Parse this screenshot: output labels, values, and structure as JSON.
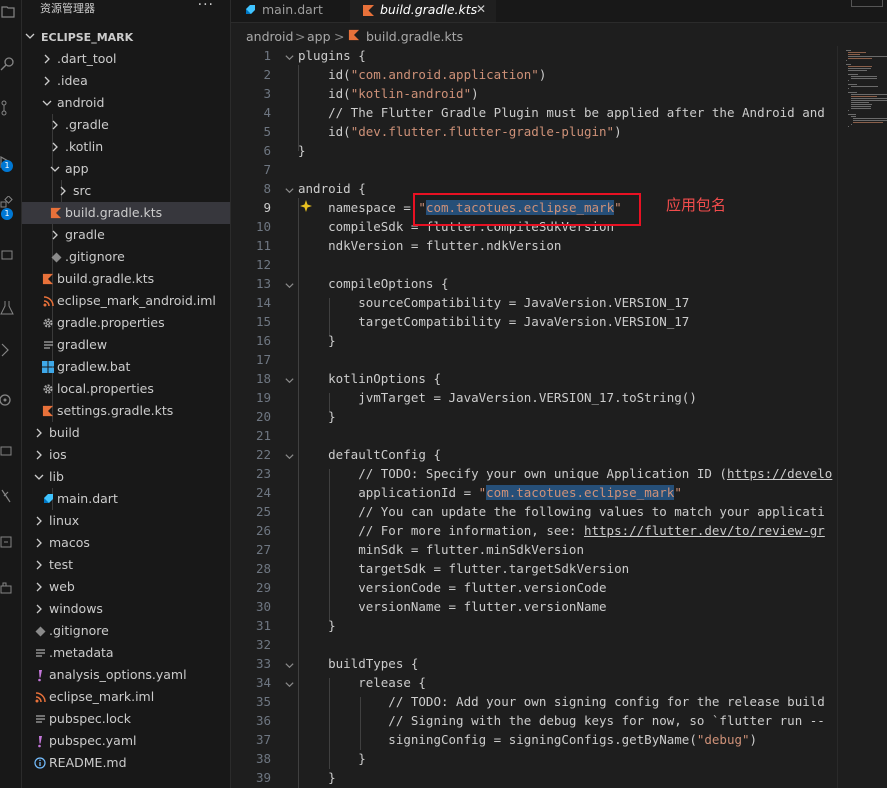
{
  "sidebar": {
    "title": "资源管理器",
    "more": "···",
    "root": "ECLIPSE_MARK",
    "items": [
      {
        "label": ".dart_tool",
        "icon": "chevron-right-icon"
      },
      {
        "label": ".idea",
        "icon": "chevron-right-icon"
      },
      {
        "label": "android",
        "icon": "chevron-down-icon"
      },
      {
        "label": ".gradle",
        "icon": "chevron-right-icon"
      },
      {
        "label": ".kotlin",
        "icon": "chevron-right-icon"
      },
      {
        "label": "app",
        "icon": "chevron-down-icon"
      },
      {
        "label": "src",
        "icon": "chevron-right-icon"
      },
      {
        "label": "build.gradle.kts",
        "icon": "kotlin-icon"
      },
      {
        "label": "gradle",
        "icon": "chevron-right-icon"
      },
      {
        "label": ".gitignore",
        "icon": "git-icon"
      },
      {
        "label": "build.gradle.kts",
        "icon": "kotlin-icon"
      },
      {
        "label": "eclipse_mark_android.iml",
        "icon": "rss-icon"
      },
      {
        "label": "gradle.properties",
        "icon": "gear-icon"
      },
      {
        "label": "gradlew",
        "icon": "lines-icon"
      },
      {
        "label": "gradlew.bat",
        "icon": "windows-icon"
      },
      {
        "label": "local.properties",
        "icon": "gear-icon"
      },
      {
        "label": "settings.gradle.kts",
        "icon": "kotlin-icon"
      },
      {
        "label": "build",
        "icon": "chevron-right-icon"
      },
      {
        "label": "ios",
        "icon": "chevron-right-icon"
      },
      {
        "label": "lib",
        "icon": "chevron-down-icon"
      },
      {
        "label": "main.dart",
        "icon": "dart-icon"
      },
      {
        "label": "linux",
        "icon": "chevron-right-icon"
      },
      {
        "label": "macos",
        "icon": "chevron-right-icon"
      },
      {
        "label": "test",
        "icon": "chevron-right-icon"
      },
      {
        "label": "web",
        "icon": "chevron-right-icon"
      },
      {
        "label": "windows",
        "icon": "chevron-right-icon"
      },
      {
        "label": ".gitignore",
        "icon": "git-icon"
      },
      {
        "label": ".metadata",
        "icon": "lines-icon"
      },
      {
        "label": "analysis_options.yaml",
        "icon": "exclamation-icon"
      },
      {
        "label": "eclipse_mark.iml",
        "icon": "rss-icon"
      },
      {
        "label": "pubspec.lock",
        "icon": "lines-icon"
      },
      {
        "label": "pubspec.yaml",
        "icon": "exclamation-icon"
      },
      {
        "label": "README.md",
        "icon": "info-icon"
      }
    ]
  },
  "activity": {
    "badges": [
      "1",
      "1"
    ]
  },
  "tabs": [
    {
      "label": "main.dart",
      "active": false
    },
    {
      "label": "build.gradle.kts",
      "active": true
    }
  ],
  "tab_close": "✕",
  "breadcrumb": [
    "android",
    "app",
    "build.gradle.kts"
  ],
  "breadcrumb_sep": ">",
  "editor": {
    "lines": [
      "plugins {",
      "    id(\"com.android.application\")",
      "    id(\"kotlin-android\")",
      "    // The Flutter Gradle Plugin must be applied after the Android and",
      "    id(\"dev.flutter.flutter-gradle-plugin\")",
      "}",
      "",
      "android {",
      "    namespace = \"com.tacotues.eclipse_mark\"",
      "    compileSdk = flutter.compileSdkVersion",
      "    ndkVersion = flutter.ndkVersion",
      "",
      "    compileOptions {",
      "        sourceCompatibility = JavaVersion.VERSION_17",
      "        targetCompatibility = JavaVersion.VERSION_17",
      "    }",
      "",
      "    kotlinOptions {",
      "        jvmTarget = JavaVersion.VERSION_17.toString()",
      "    }",
      "",
      "    defaultConfig {",
      "        // TODO: Specify your own unique Application ID (https://develo",
      "        applicationId = \"com.tacotues.eclipse_mark\"",
      "        // You can update the following values to match your applicati",
      "        // For more information, see: https://flutter.dev/to/review-gr",
      "        minSdk = flutter.minSdkVersion",
      "        targetSdk = flutter.targetSdkVersion",
      "        versionCode = flutter.versionCode",
      "        versionName = flutter.versionName",
      "    }",
      "",
      "    buildTypes {",
      "        release {",
      "            // TODO: Add your own signing config for the release build",
      "            // Signing with the debug keys for now, so `flutter run --",
      "            signingConfig = signingConfigs.getByName(\"debug\")",
      "        }",
      "    }"
    ],
    "current_line": 9,
    "annotation": "应用包名"
  }
}
